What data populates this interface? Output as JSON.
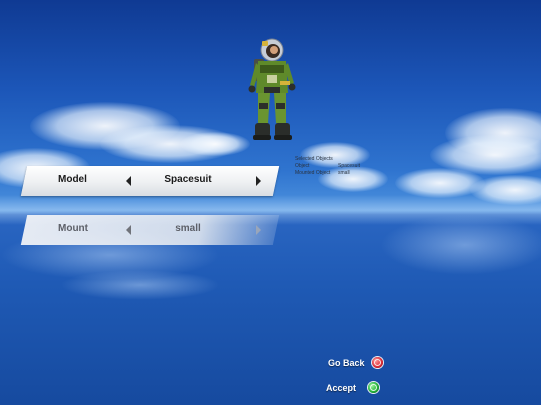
{
  "options": {
    "model": {
      "label": "Model",
      "value": "Spacesuit"
    },
    "mount": {
      "label": "Mount",
      "value": "small"
    }
  },
  "info": {
    "heading": "Selected Objects",
    "object_label": "Object",
    "object_value": "Spacesuit",
    "mounted_label": "Mounted Object",
    "mounted_value": "small"
  },
  "buttons": {
    "go_back": "Go Back",
    "accept": "Accept"
  },
  "colors": {
    "back_button": "#e0303a",
    "accept_button": "#26b53a",
    "suit_green": "#5f8a2a",
    "suit_dark": "#2c2f2a"
  }
}
